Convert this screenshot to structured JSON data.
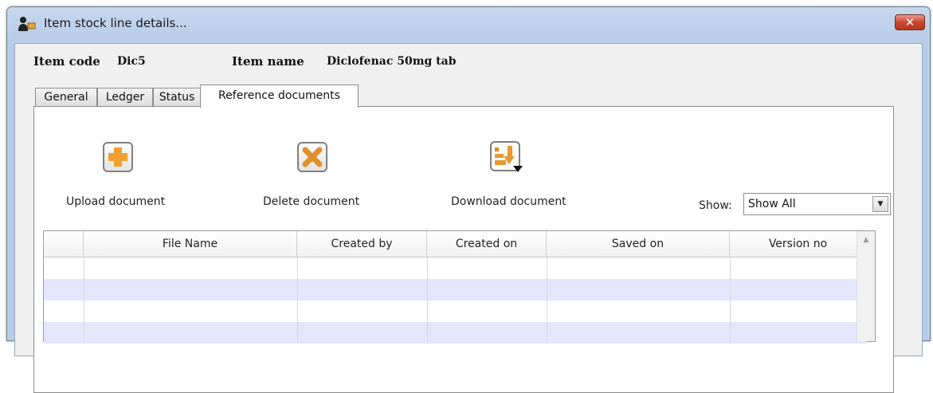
{
  "window": {
    "title": "Item stock line details...",
    "close_glyph": "✕"
  },
  "header": {
    "item_code_label": "Item code",
    "item_code_value": "Dic5",
    "item_name_label": "Item name",
    "item_name_value": "Diclofenac 50mg tab"
  },
  "tabs": [
    {
      "label": "General"
    },
    {
      "label": "Ledger"
    },
    {
      "label": "Status"
    },
    {
      "label": "Reference documents",
      "active": true
    }
  ],
  "toolbar": {
    "upload_label": "Upload document",
    "delete_label": "Delete document",
    "download_label": "Download document"
  },
  "filter": {
    "show_label": "Show:",
    "show_value": "Show All"
  },
  "table": {
    "columns": [
      "File Name",
      "Created by",
      "Created on",
      "Saved on",
      "Version no"
    ],
    "rows": []
  },
  "colors": {
    "title_bar": "#b9cde8",
    "close_button": "#c9472f",
    "upload_icon": "#f0a030",
    "delete_icon": "#e0902a",
    "row_alt": "#e4e6fc"
  },
  "icons": {
    "app": "user-box-icon",
    "upload": "plus-icon",
    "delete": "x-icon",
    "download": "download-icon"
  }
}
